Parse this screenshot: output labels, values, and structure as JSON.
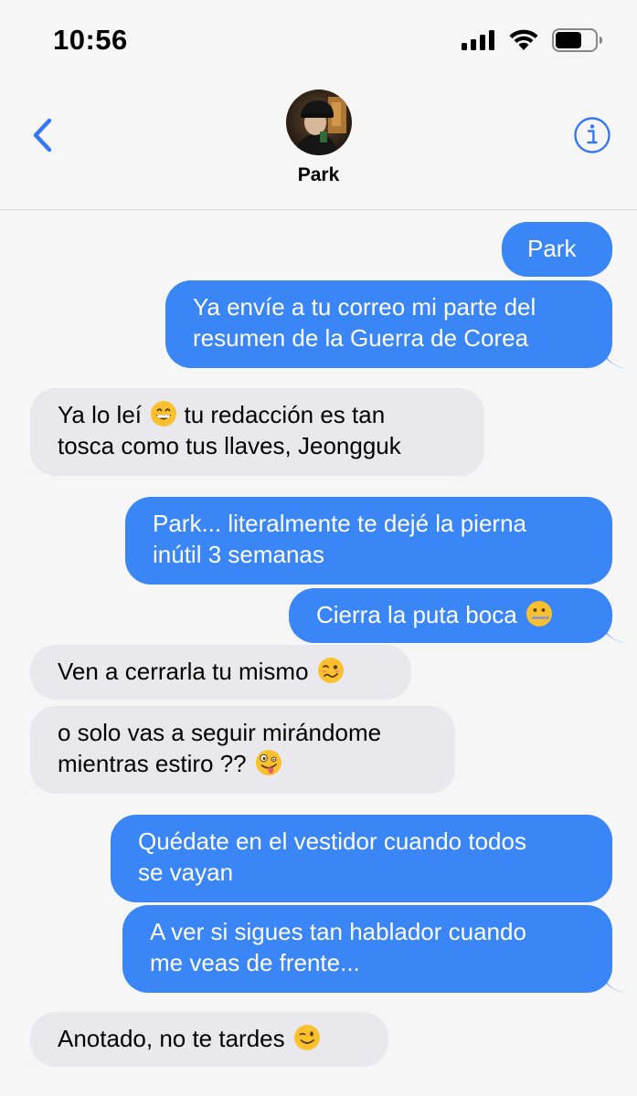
{
  "status_bar": {
    "time": "10:56"
  },
  "header": {
    "contact_name": "Park",
    "back_icon": "chevron-left-icon",
    "info_icon": "info-circle-icon"
  },
  "colors": {
    "outgoing_bubble": "#3b86f7",
    "incoming_bubble": "#e9e8ed",
    "accent": "#3478f6",
    "background": "#f6f6f6"
  },
  "messages": [
    {
      "direction": "outgoing",
      "lines": [
        "Park"
      ]
    },
    {
      "direction": "outgoing",
      "lines": [
        "Ya envíe a tu correo mi parte del",
        "resumen de la Guerra de Corea"
      ]
    },
    {
      "direction": "incoming",
      "lines": [
        "Ya lo leí",
        "tu redacción es tan",
        "tosca como tus llaves, Jeongguk"
      ],
      "emoji": "grinning-face"
    },
    {
      "direction": "outgoing",
      "lines": [
        "Park... literalmente te dejé la pierna",
        "inútil 3 semanas"
      ]
    },
    {
      "direction": "outgoing",
      "lines": [
        "Cierra la puta boca"
      ],
      "emoji": "zipper-mouth-face"
    },
    {
      "direction": "incoming",
      "lines": [
        "Ven a cerrarla tu mismo"
      ],
      "emoji": "woozy-face"
    },
    {
      "direction": "incoming",
      "lines": [
        "o solo vas a seguir mirándome",
        "mientras estiro ??"
      ],
      "emoji": "zany-face"
    },
    {
      "direction": "outgoing",
      "lines": [
        "Quédate en el vestidor cuando todos",
        "se vayan"
      ]
    },
    {
      "direction": "outgoing",
      "lines": [
        "A ver si sigues tan hablador cuando",
        "me veas de frente..."
      ]
    },
    {
      "direction": "incoming",
      "lines": [
        "Anotado, no te tardes"
      ],
      "emoji": "winking-face"
    }
  ]
}
